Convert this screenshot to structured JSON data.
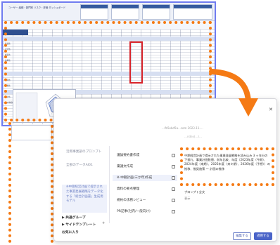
{
  "sheet": {
    "title": "ユーザー 組織・部門別 リスク・評価 ダッシュボード",
    "row_labels": [
      "収益性",
      "安全性",
      "成長性",
      "効率性",
      "生産性",
      "流動性",
      "健全性",
      "その他指標"
    ]
  },
  "dialog": {
    "faint_line1": "…fb5ebd5a...com 2023-11-...",
    "faint_line2": "…ndex(…)…"
  },
  "left_column": {
    "item1": "活用事業部のプロンプト",
    "item2": "全部のデータAI01",
    "active_item": "※中期経営計画で提示された事業発展戦略をデータ化する「総合計画書」生成用モデル",
    "nav_group": "共通グループ",
    "nav_template": "サイドテンプレート",
    "nav_favorite": "お気に入り",
    "expander": "▶",
    "plus": "+"
  },
  "middle_column": {
    "items": [
      "議論要約書作成",
      "稟議文作成",
      "※ 中期計画(三か年)作成",
      "資料の要点整理",
      "規約の法務レビュー",
      "PR記事(社内/一般向け)"
    ],
    "active_index": 2
  },
  "right_panel": {
    "description": "中期経営計画で提示された事業発展戦略を読み込み 3 ヶ年分の下振れ、事業計画数値、前年比較、年度（2023年度〈今期〉、2024年度〈来期〉、2025年度〈来々期〉、2026年度〈予想〉）の推移、推奨施策 ～ 計画の推移",
    "label_prompt": "プロンプト全文",
    "label_detail": "表示"
  },
  "buttons": {
    "cancel": "編集する",
    "confirm": "適用する"
  },
  "icons": {
    "close": "✕"
  },
  "colors": {
    "highlight": "#f57a14",
    "accent": "#4a64c8",
    "red_highlight": "#d8242a"
  }
}
